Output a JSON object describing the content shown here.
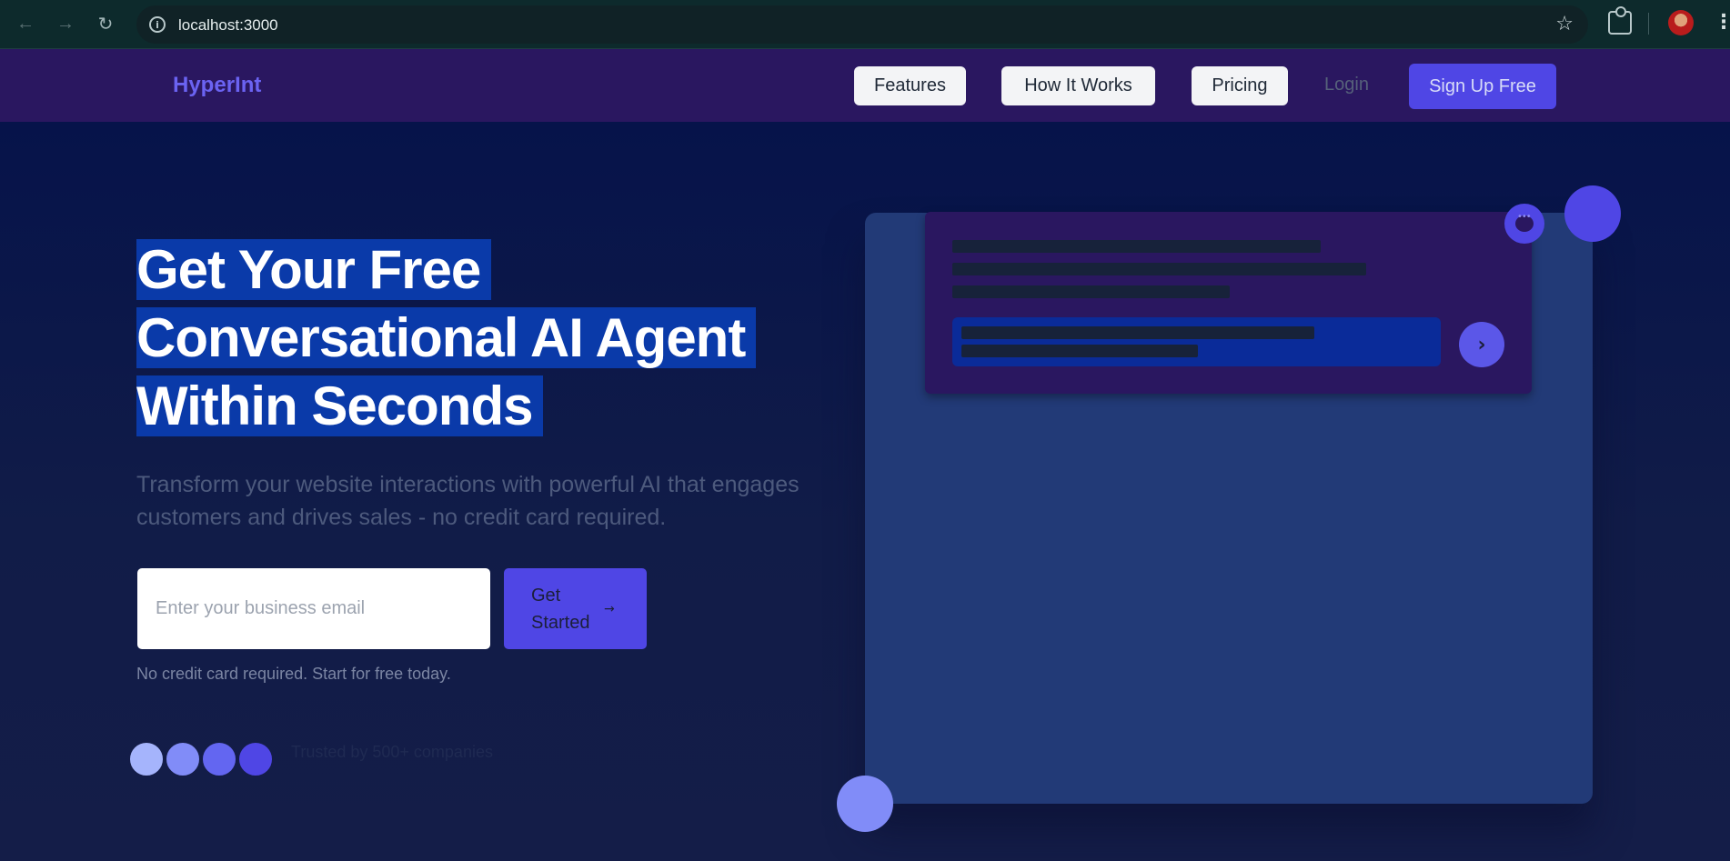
{
  "browser": {
    "url": "localhost:3000"
  },
  "nav": {
    "logo": "HyperInt",
    "links": [
      {
        "label": "Features"
      },
      {
        "label": "How It Works"
      },
      {
        "label": "Pricing"
      }
    ],
    "login_label": "Login",
    "signup_label": "Sign Up Free"
  },
  "hero": {
    "headline_lines": [
      "Get Your Free",
      "Conversational AI Agent",
      "Within Seconds"
    ],
    "subtitle": "Transform your website interactions with powerful AI that engages customers and drives sales - no credit card required.",
    "email_placeholder": "Enter your business email",
    "cta_label": "Get Started",
    "cta_icon": "arrow-right-icon",
    "note": "No credit card required. Start for free today.",
    "trusted_text": "Trusted by 500+ companies",
    "avatar_colors": [
      "#a5b4fc",
      "#818cf8",
      "#6366f1",
      "#4f46e5"
    ]
  },
  "mockup": {
    "send_icon": "chevron-right-icon",
    "badge_icon": "chat-bubble-icon"
  },
  "colors": {
    "brand": "#4f46e5",
    "nav_bg": "#2a1760",
    "headline_highlight": "#0a3aa9",
    "card_bg": "#223a77"
  }
}
